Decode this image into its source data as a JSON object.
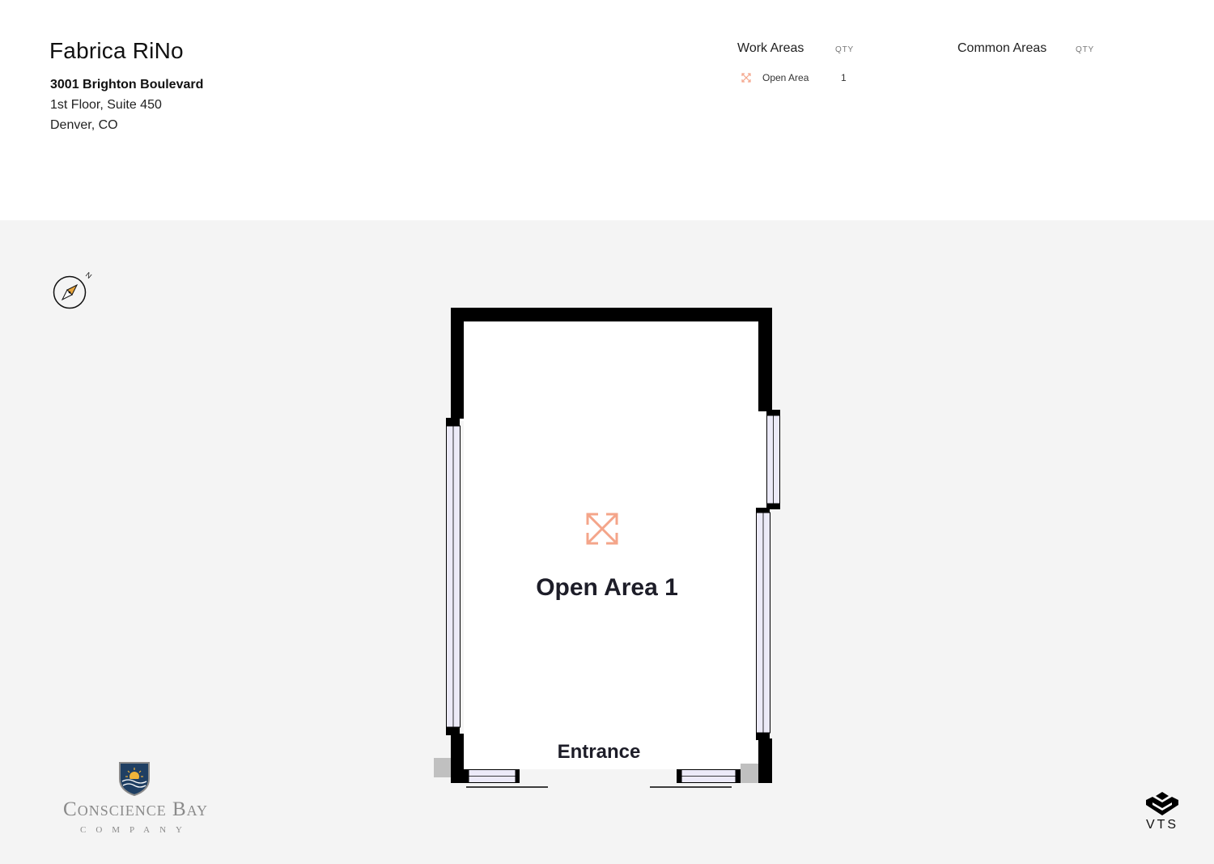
{
  "header": {
    "title": "Fabrica RiNo",
    "address_line1": "3001 Brighton Boulevard",
    "address_line2": "1st Floor, Suite 450",
    "address_line3": "Denver, CO"
  },
  "legend": {
    "work_areas_label": "Work Areas",
    "common_areas_label": "Common Areas",
    "qty_label": "QTY",
    "work_items": [
      {
        "label": "Open Area",
        "qty": "1",
        "icon": "open-area-icon",
        "color": "#f4a58a"
      }
    ]
  },
  "floorplan": {
    "room_name": "Open Area 1",
    "entrance_label": "Entrance",
    "room_icon": "open-area-icon",
    "icon_color": "#f4a58a",
    "wall_color": "#000000",
    "window_color": "#eceaf8",
    "room_fill": "#ffffff",
    "background": "#f4f4f4"
  },
  "compass": {
    "north_label": "N"
  },
  "branding": {
    "company_word": "Conscience Bay",
    "company_sub": "COMPANY",
    "vts_word": "VTS"
  }
}
